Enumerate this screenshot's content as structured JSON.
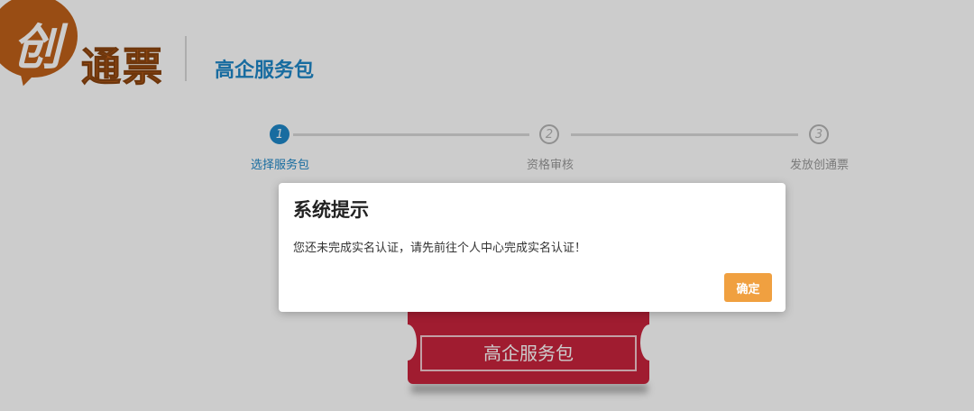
{
  "header": {
    "logo_char": "创",
    "logo_text": "通票",
    "page_title": "高企服务包"
  },
  "steps": [
    {
      "number": "1",
      "label": "选择服务包",
      "active": true
    },
    {
      "number": "2",
      "label": "资格审核",
      "active": false
    },
    {
      "number": "3",
      "label": "发放创通票",
      "active": false
    }
  ],
  "ticket": {
    "label": "高企服务包"
  },
  "modal": {
    "title": "系统提示",
    "message": "您还未完成实名认证，请先前往个人中心完成实名认证！",
    "confirm_label": "确定"
  },
  "colors": {
    "accent": "#1e88c8",
    "logo": "#c0611a",
    "ticket": "#c9243d",
    "button": "#f0a040"
  }
}
